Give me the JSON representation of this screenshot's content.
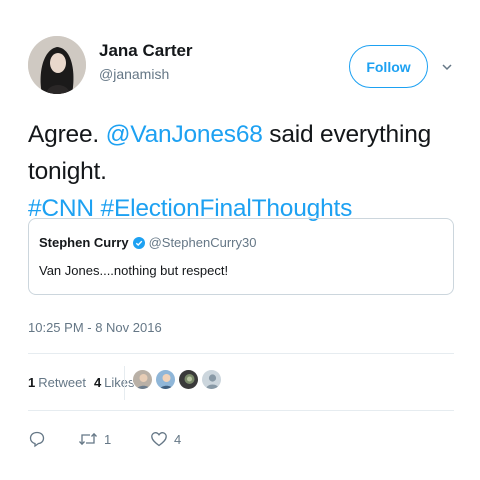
{
  "author": {
    "name": "Jana Carter",
    "handle": "@janamish",
    "follow_label": "Follow"
  },
  "tweet": {
    "text_plain_1": "Agree. ",
    "mention": "@VanJones68",
    "text_plain_2": " said everything tonight.",
    "hashtag_1": "#CNN",
    "hashtag_2": "#ElectionFinalThoughts"
  },
  "quoted": {
    "name": "Stephen Curry",
    "handle": "@StephenCurry30",
    "text": "Van Jones....nothing but respect!"
  },
  "timestamp": "10:25 PM - 8 Nov 2016",
  "stats": {
    "retweets_count": "1",
    "retweets_label": "Retweet",
    "likes_count": "4",
    "likes_label": "Likes"
  },
  "actions": {
    "reply_icon": "reply-icon",
    "retweet_icon": "retweet-icon",
    "retweet_count": "1",
    "like_icon": "heart-icon",
    "like_count": "4"
  },
  "colors": {
    "link": "#1da1f2",
    "muted": "#657786",
    "text": "#14171a",
    "border": "#ccd6dd"
  }
}
